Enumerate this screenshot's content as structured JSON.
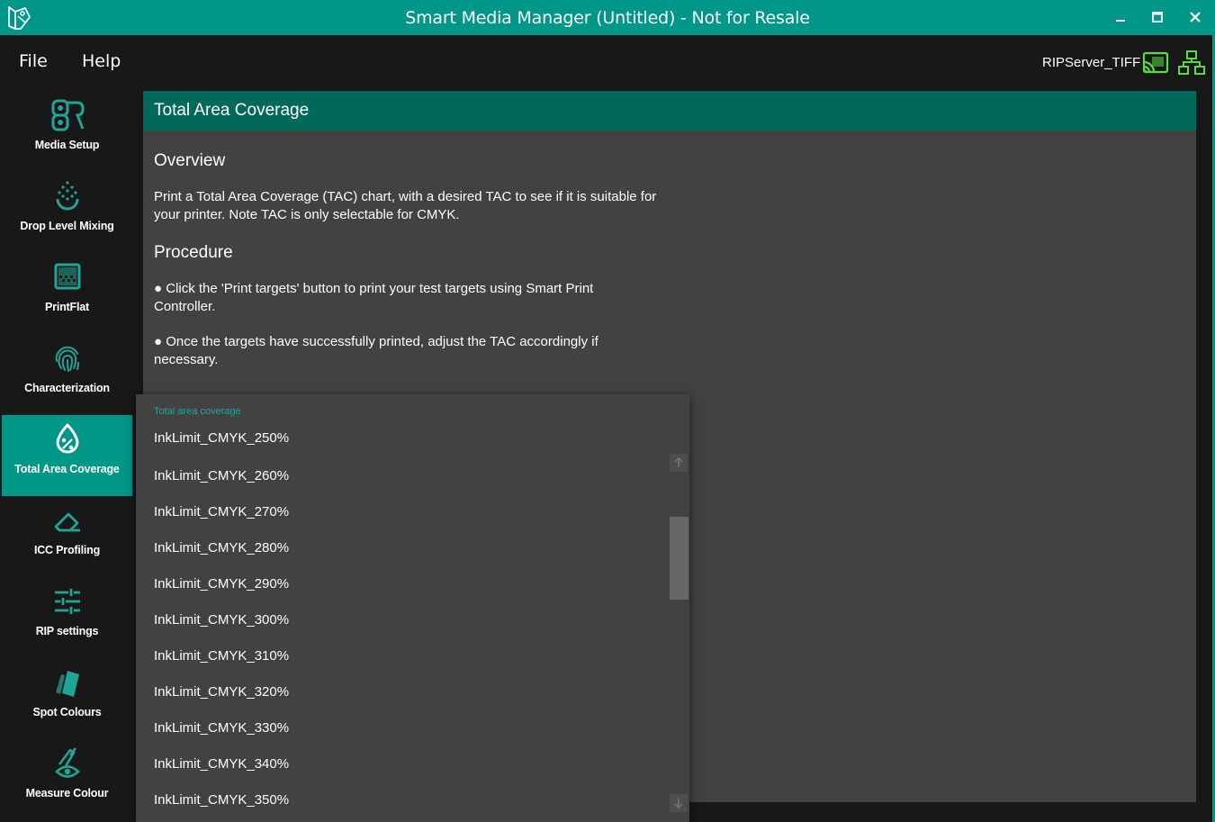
{
  "window": {
    "title": "Smart Media Manager (Untitled) - Not for Resale",
    "accent_color": "#009688",
    "header_color": "#00695c",
    "panel_color": "#424242",
    "controls": [
      "minimize-icon",
      "maximize-icon",
      "close-icon"
    ]
  },
  "menu": {
    "file_label": "File",
    "help_label": "Help",
    "server_name": "RIPServer_TIFF",
    "status_color": "#5cd94a"
  },
  "sidebar": {
    "items": [
      {
        "label": "Media Setup",
        "icon": "media-setup-icon"
      },
      {
        "label": "Drop Level Mixing",
        "icon": "drop-level-icon"
      },
      {
        "label": "PrintFlat",
        "icon": "printflat-icon"
      },
      {
        "label": "Characterization",
        "icon": "fingerprint-icon"
      },
      {
        "label": "Total Area Coverage",
        "icon": "drop-percent-icon",
        "active": true
      },
      {
        "label": "ICC Profiling",
        "icon": "eraser-icon"
      },
      {
        "label": "RIP settings",
        "icon": "sliders-icon"
      },
      {
        "label": "Spot Colours",
        "icon": "swatch-icon"
      },
      {
        "label": "Measure Colour",
        "icon": "measure-eye-icon"
      }
    ]
  },
  "main": {
    "title": "Total Area Coverage",
    "overview_heading": "Overview",
    "overview_text": "Print a Total Area Coverage (TAC) chart, with a desired TAC to see if it is suitable for your printer. Note TAC is only selectable for CMYK.",
    "procedure_heading": "Procedure",
    "step1": "● Click the 'Print targets' button to print your test targets using Smart Print Controller.",
    "step2": "● Once the targets have successfully printed, adjust the TAC accordingly if necessary."
  },
  "dropdown": {
    "label": "Total area coverage",
    "options": [
      "InkLimit_CMYK_250%",
      "InkLimit_CMYK_260%",
      "InkLimit_CMYK_270%",
      "InkLimit_CMYK_280%",
      "InkLimit_CMYK_290%",
      "InkLimit_CMYK_300%",
      "InkLimit_CMYK_310%",
      "InkLimit_CMYK_320%",
      "InkLimit_CMYK_330%",
      "InkLimit_CMYK_340%",
      "InkLimit_CMYK_350%"
    ]
  }
}
